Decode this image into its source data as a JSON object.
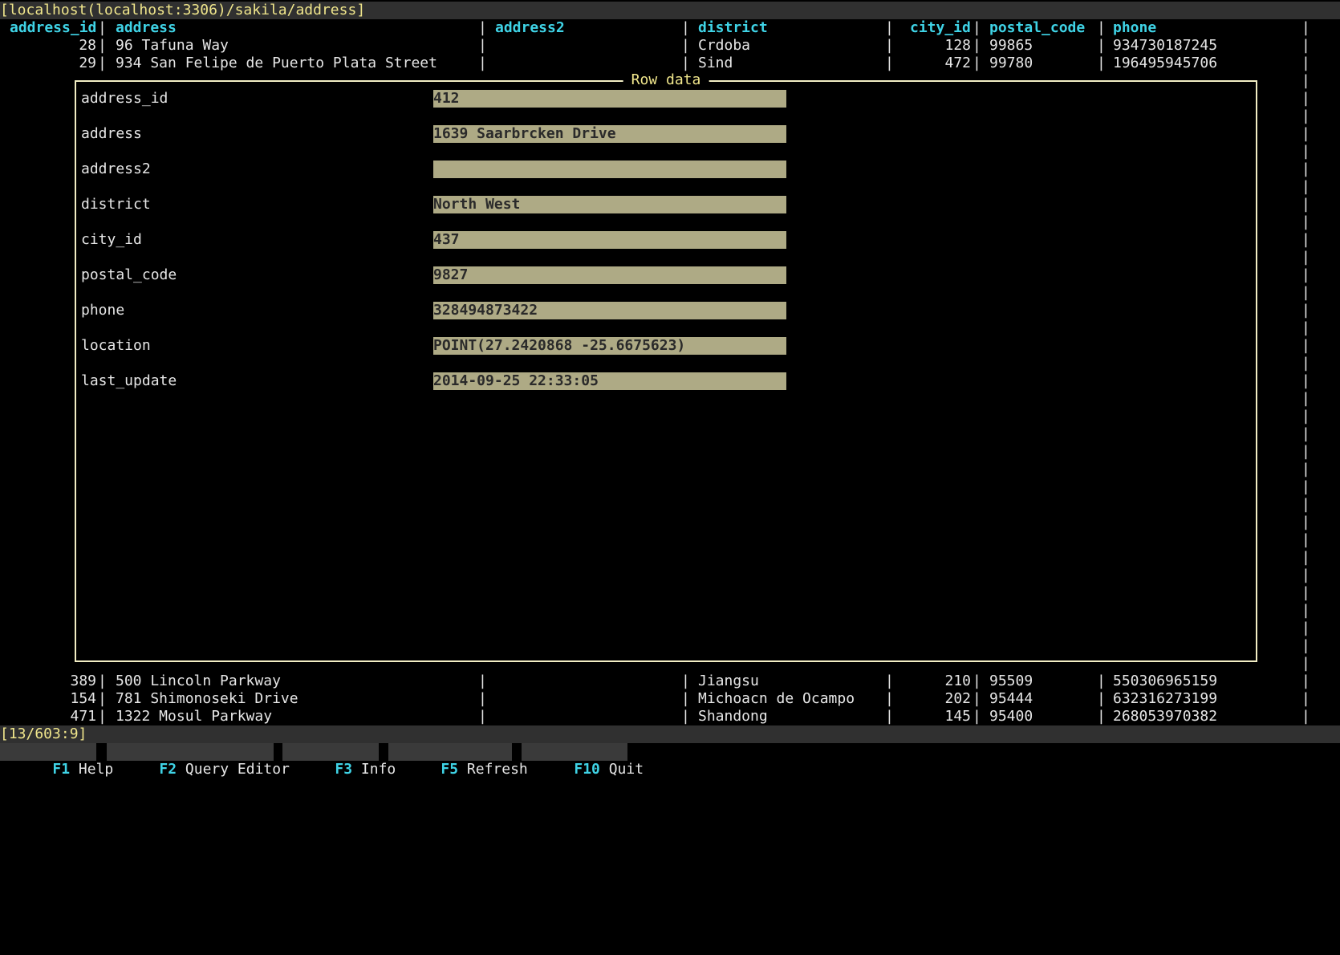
{
  "title": "[localhost(localhost:3306)/sakila/address]",
  "columns": {
    "address_id": "address_id",
    "address": "address",
    "address2": "address2",
    "district": "district",
    "city_id": "city_id",
    "postal_code": "postal_code",
    "phone": "phone"
  },
  "rows": [
    {
      "address_id": "28",
      "address": "96 Tafuna Way",
      "address2": "",
      "district": "Crdoba",
      "city_id": "128",
      "postal_code": "99865",
      "phone": "934730187245"
    },
    {
      "address_id": "29",
      "address": "934 San Felipe de Puerto Plata Street",
      "address2": "",
      "district": "Sind",
      "city_id": "472",
      "postal_code": "99780",
      "phone": "196495945706"
    },
    {
      "address_id": "389",
      "address": "500 Lincoln Parkway",
      "address2": "",
      "district": "Jiangsu",
      "city_id": "210",
      "postal_code": "95509",
      "phone": "550306965159"
    },
    {
      "address_id": "154",
      "address": "781 Shimonoseki Drive",
      "address2": "",
      "district": "Michoacn de Ocampo",
      "city_id": "202",
      "postal_code": "95444",
      "phone": "632316273199"
    },
    {
      "address_id": "471",
      "address": "1322 Mosul Parkway",
      "address2": "",
      "district": "Shandong",
      "city_id": "145",
      "postal_code": "95400",
      "phone": "268053970382"
    }
  ],
  "dialog": {
    "title": "Row data",
    "fields": [
      {
        "label": "address_id",
        "value": "412"
      },
      {
        "label": "address",
        "value": "1639 Saarbrcken Drive"
      },
      {
        "label": "address2",
        "value": ""
      },
      {
        "label": "district",
        "value": "North West"
      },
      {
        "label": "city_id",
        "value": "437"
      },
      {
        "label": "postal_code",
        "value": "9827"
      },
      {
        "label": "phone",
        "value": "328494873422"
      },
      {
        "label": "location",
        "value": "POINT(27.2420868 -25.6675623)"
      },
      {
        "label": "last_update",
        "value": "2014-09-25 22:33:05"
      }
    ]
  },
  "status": "[13/603:9]",
  "fkeys": [
    {
      "key": "F1",
      "label": "Help"
    },
    {
      "key": "F2",
      "label": "Query Editor"
    },
    {
      "key": "F3",
      "label": "Info"
    },
    {
      "key": "F5",
      "label": "Refresh"
    },
    {
      "key": "F10",
      "label": "Quit"
    }
  ],
  "colors": {
    "header": "#3fd3e6",
    "title": "#f0e68c",
    "field_bg": "#aeaa85"
  }
}
